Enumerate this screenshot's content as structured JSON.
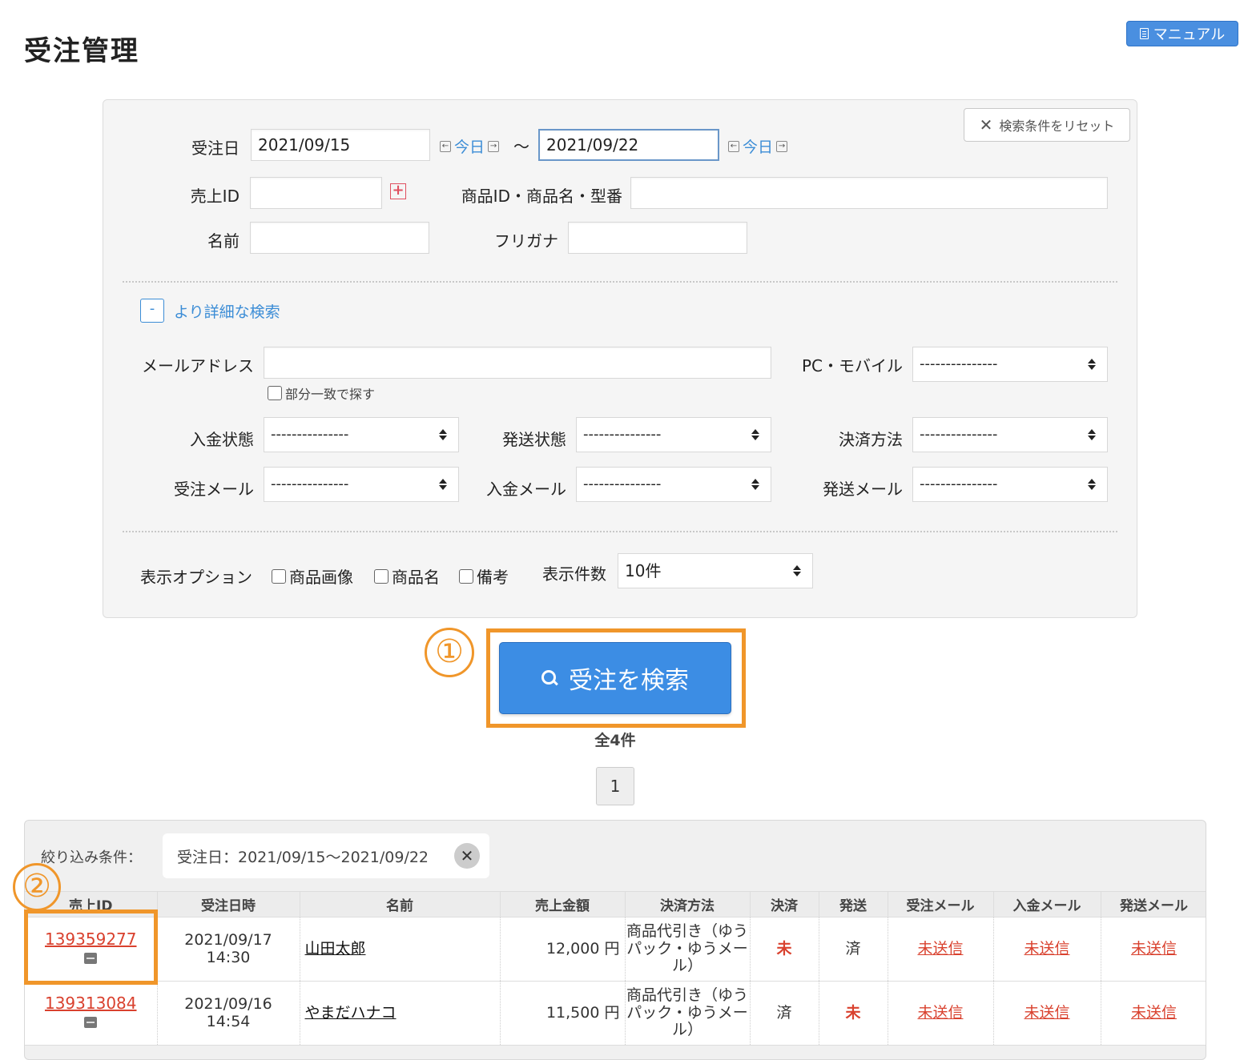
{
  "page": {
    "title": "受注管理",
    "manual_label": "マニュアル"
  },
  "search": {
    "reset_label": "検索条件をリセット",
    "order_date_label": "受注日",
    "date_from": "2021/09/15",
    "date_to": "2021/09/22",
    "today_label": "今日",
    "tilde": "〜",
    "sales_id_label": "売上ID",
    "sales_id_value": "",
    "product_label": "商品ID・商品名・型番",
    "name_label": "名前",
    "kana_label": "フリガナ",
    "detail_toggle": "-",
    "detail_label": "より詳細な検索",
    "email_label": "メールアドレス",
    "partial_match_label": "部分一致で探す",
    "device_label": "PC・モバイル",
    "payment_status_label": "入金状態",
    "shipping_status_label": "発送状態",
    "payment_method_label": "決済方法",
    "order_mail_label": "受注メール",
    "payment_mail_label": "入金メール",
    "shipping_mail_label": "発送メール",
    "select_placeholder": "---------------",
    "display_option_label": "表示オプション",
    "opt_image": "商品画像",
    "opt_name": "商品名",
    "opt_note": "備考",
    "per_page_label": "表示件数",
    "per_page_value": "10件",
    "submit_label": "受注を検索"
  },
  "annotations": {
    "step1": "①",
    "step2": "②"
  },
  "results": {
    "total": "全4件",
    "page": "1",
    "filter_label": "絞り込み条件：",
    "filter_chip": "受注日：2021/09/15〜2021/09/22",
    "filter_remove": "✕",
    "columns": [
      "売上ID",
      "受注日時",
      "名前",
      "売上金額",
      "決済方法",
      "決済",
      "発送",
      "受注メール",
      "入金メール",
      "発送メール"
    ],
    "rows": [
      {
        "id": "139359277",
        "date": "2021/09/17",
        "time": "14:30",
        "name": "山田太郎",
        "amount": "12,000 円",
        "method": "商品代引き（ゆうパック・ゆうメール）",
        "paid": "未",
        "shipped": "済",
        "order_mail": "未送信",
        "payment_mail": "未送信",
        "shipping_mail": "未送信"
      },
      {
        "id": "139313084",
        "date": "2021/09/16",
        "time": "14:54",
        "name": "やまだハナコ",
        "amount": "11,500 円",
        "method": "商品代引き（ゆうパック・ゆうメール）",
        "paid": "済",
        "shipped": "未",
        "order_mail": "未送信",
        "payment_mail": "未送信",
        "shipping_mail": "未送信"
      }
    ]
  },
  "colors": {
    "accent": "#3c8de4",
    "highlight": "#f0962a",
    "alert": "#d9412e"
  }
}
